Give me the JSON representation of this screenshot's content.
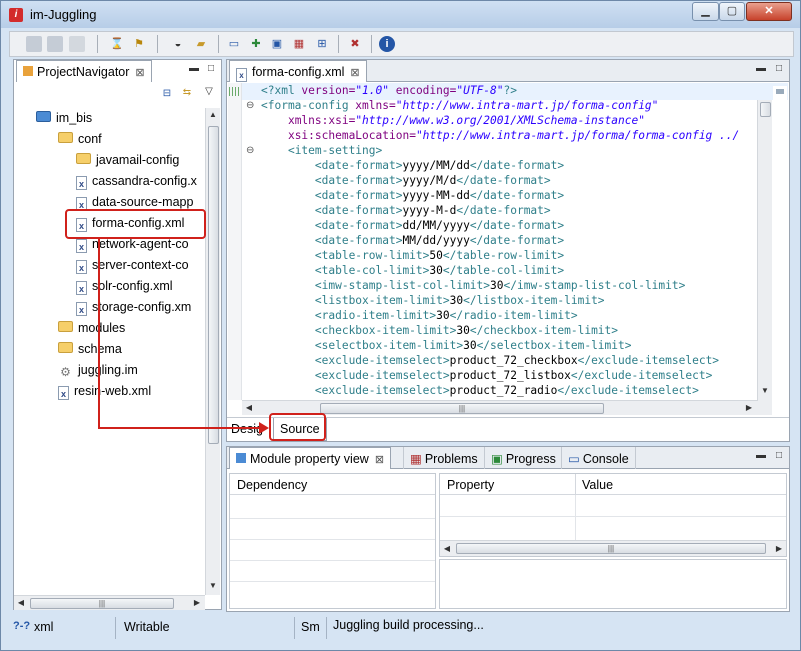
{
  "window": {
    "title": "im-Juggling"
  },
  "navigator": {
    "tab_label": "ProjectNavigator",
    "close_glyph": "⊠",
    "items": [
      {
        "label": "im_bis",
        "icon": "project-icon"
      },
      {
        "label": "conf",
        "icon": "folder-icon"
      },
      {
        "label": "javamail-config",
        "icon": "folder-icon"
      },
      {
        "label": "cassandra-config.x",
        "icon": "xml-file-icon"
      },
      {
        "label": "data-source-mapp",
        "icon": "xml-file-icon"
      },
      {
        "label": "forma-config.xml",
        "icon": "xml-file-icon"
      },
      {
        "label": "network-agent-co",
        "icon": "xml-file-icon"
      },
      {
        "label": "server-context-co",
        "icon": "xml-file-icon"
      },
      {
        "label": "solr-config.xml",
        "icon": "xml-file-icon"
      },
      {
        "label": "storage-config.xm",
        "icon": "xml-file-icon"
      },
      {
        "label": "modules",
        "icon": "folder-icon"
      },
      {
        "label": "schema",
        "icon": "folder-icon"
      },
      {
        "label": "juggling.im",
        "icon": "gear-file-icon"
      },
      {
        "label": "resin-web.xml",
        "icon": "xml-file-icon"
      }
    ]
  },
  "editor": {
    "tab_label": "forma-config.xml",
    "close_glyph": "⊠",
    "bottom_tabs": {
      "design": "Desig",
      "source": "Source"
    },
    "lines": [
      [
        [
          "pi",
          "<?xml "
        ],
        [
          "attr",
          "version="
        ],
        [
          "val",
          "\"1.0\""
        ],
        [
          "attr",
          " encoding="
        ],
        [
          "val",
          "\"UTF-8\""
        ],
        [
          "pi",
          "?>"
        ]
      ],
      [
        [
          "tag",
          "<forma-config "
        ],
        [
          "attr",
          "xmlns="
        ],
        [
          "val",
          "\"http://www.intra-mart.jp/forma-config\""
        ]
      ],
      [
        [
          "txt",
          "    "
        ],
        [
          "attr",
          "xmlns:xsi="
        ],
        [
          "val",
          "\"http://www.w3.org/2001/XMLSchema-instance\""
        ]
      ],
      [
        [
          "txt",
          "    "
        ],
        [
          "attr",
          "xsi:schemaLocation="
        ],
        [
          "val",
          "\"http://www.intra-mart.jp/forma/forma-config ../"
        ]
      ],
      [
        [
          "txt",
          "    "
        ],
        [
          "tag",
          "<item-setting>"
        ]
      ],
      [
        [
          "txt",
          "        "
        ],
        [
          "tag",
          "<date-format>"
        ],
        [
          "txt",
          "yyyy/MM/dd"
        ],
        [
          "tag",
          "</date-format>"
        ]
      ],
      [
        [
          "txt",
          "        "
        ],
        [
          "tag",
          "<date-format>"
        ],
        [
          "txt",
          "yyyy/M/d"
        ],
        [
          "tag",
          "</date-format>"
        ]
      ],
      [
        [
          "txt",
          "        "
        ],
        [
          "tag",
          "<date-format>"
        ],
        [
          "txt",
          "yyyy-MM-dd"
        ],
        [
          "tag",
          "</date-format>"
        ]
      ],
      [
        [
          "txt",
          "        "
        ],
        [
          "tag",
          "<date-format>"
        ],
        [
          "txt",
          "yyyy-M-d"
        ],
        [
          "tag",
          "</date-format>"
        ]
      ],
      [
        [
          "txt",
          "        "
        ],
        [
          "tag",
          "<date-format>"
        ],
        [
          "txt",
          "dd/MM/yyyy"
        ],
        [
          "tag",
          "</date-format>"
        ]
      ],
      [
        [
          "txt",
          "        "
        ],
        [
          "tag",
          "<date-format>"
        ],
        [
          "txt",
          "MM/dd/yyyy"
        ],
        [
          "tag",
          "</date-format>"
        ]
      ],
      [
        [
          "txt",
          "        "
        ],
        [
          "tag",
          "<table-row-limit>"
        ],
        [
          "txt",
          "50"
        ],
        [
          "tag",
          "</table-row-limit>"
        ]
      ],
      [
        [
          "txt",
          "        "
        ],
        [
          "tag",
          "<table-col-limit>"
        ],
        [
          "txt",
          "30"
        ],
        [
          "tag",
          "</table-col-limit>"
        ]
      ],
      [
        [
          "txt",
          "        "
        ],
        [
          "tag",
          "<imw-stamp-list-col-limit>"
        ],
        [
          "txt",
          "30"
        ],
        [
          "tag",
          "</imw-stamp-list-col-limit>"
        ]
      ],
      [
        [
          "txt",
          "        "
        ],
        [
          "tag",
          "<listbox-item-limit>"
        ],
        [
          "txt",
          "30"
        ],
        [
          "tag",
          "</listbox-item-limit>"
        ]
      ],
      [
        [
          "txt",
          "        "
        ],
        [
          "tag",
          "<radio-item-limit>"
        ],
        [
          "txt",
          "30"
        ],
        [
          "tag",
          "</radio-item-limit>"
        ]
      ],
      [
        [
          "txt",
          "        "
        ],
        [
          "tag",
          "<checkbox-item-limit>"
        ],
        [
          "txt",
          "30"
        ],
        [
          "tag",
          "</checkbox-item-limit>"
        ]
      ],
      [
        [
          "txt",
          "        "
        ],
        [
          "tag",
          "<selectbox-item-limit>"
        ],
        [
          "txt",
          "30"
        ],
        [
          "tag",
          "</selectbox-item-limit>"
        ]
      ],
      [
        [
          "txt",
          "        "
        ],
        [
          "tag",
          "<exclude-itemselect>"
        ],
        [
          "txt",
          "product_72_checkbox"
        ],
        [
          "tag",
          "</exclude-itemselect>"
        ]
      ],
      [
        [
          "txt",
          "        "
        ],
        [
          "tag",
          "<exclude-itemselect>"
        ],
        [
          "txt",
          "product_72_listbox"
        ],
        [
          "tag",
          "</exclude-itemselect>"
        ]
      ],
      [
        [
          "txt",
          "        "
        ],
        [
          "tag",
          "<exclude-itemselect>"
        ],
        [
          "txt",
          "product_72_radio"
        ],
        [
          "tag",
          "</exclude-itemselect>"
        ]
      ]
    ]
  },
  "bottom_panel": {
    "tabs": [
      "Module property view",
      "Problems",
      "Progress",
      "Console"
    ],
    "close_glyph": "⊠",
    "dependency_header": "Dependency",
    "property_header": "Property",
    "value_header": "Value"
  },
  "status": {
    "file_type": "xml",
    "mode": "Writable",
    "insert_mode": "Sm",
    "message": "Juggling build processing..."
  },
  "colors": {
    "annotation": "#d0211b",
    "tag": "#2f7f8a",
    "attribute": "#7f007f",
    "value": "#2a00ff"
  }
}
